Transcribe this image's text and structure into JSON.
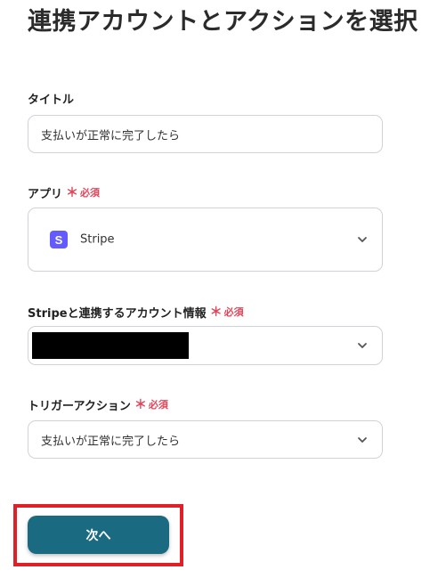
{
  "page_title": "連携アカウントとアクションを選択",
  "colors": {
    "accent": "#1a6b82",
    "required": "#e0455a",
    "stripe_brand": "#635bff",
    "highlight": "#e01f26"
  },
  "fields": {
    "title": {
      "label": "タイトル",
      "value": "支払いが正常に完了したら"
    },
    "app": {
      "label": "アプリ",
      "required_mark": "＊",
      "required_text": "必須",
      "icon": "stripe-logo-icon",
      "icon_letter": "S",
      "value": "Stripe"
    },
    "account": {
      "label": "Stripeと連携するアカウント情報",
      "required_mark": "＊",
      "required_text": "必須"
    },
    "trigger_action": {
      "label": "トリガーアクション",
      "required_mark": "＊",
      "required_text": "必須",
      "value": "支払いが正常に完了したら"
    }
  },
  "next_button": {
    "label": "次へ"
  }
}
